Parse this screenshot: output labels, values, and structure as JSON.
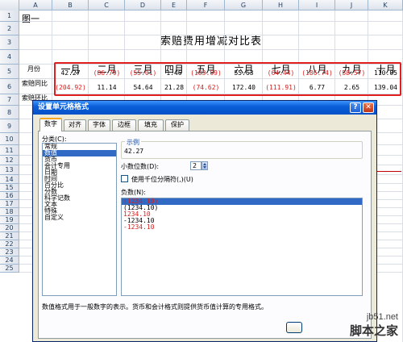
{
  "columns": [
    "A",
    "B",
    "C",
    "D",
    "E",
    "F",
    "G",
    "H",
    "I",
    "J",
    "K"
  ],
  "rows": [
    "1",
    "2",
    "3",
    "4",
    "5",
    "6",
    "7",
    "8",
    "9",
    "10",
    "11",
    "12",
    "13",
    "14",
    "15",
    "16",
    "17",
    "18",
    "19",
    "20",
    "21",
    "22",
    "23",
    "24",
    "25"
  ],
  "sheet": {
    "a1": "图一",
    "title": "索赔费用增减对比表",
    "month_header_label": "月份",
    "months": [
      "一月",
      "二月",
      "三月",
      "四月",
      "五月",
      "六月",
      "七月",
      "八月",
      "九月",
      "十月"
    ],
    "row4_label": "索赔同比",
    "row4_values": [
      "42.27",
      "(86.79)",
      "(55.01)",
      "1.46",
      "(183.69)",
      "55.63",
      "(64.44)",
      "(186.74)",
      "(58.57)",
      "110.05"
    ],
    "row4_negative": [
      false,
      true,
      true,
      false,
      true,
      false,
      true,
      true,
      true,
      false
    ],
    "row5_label": "索赔环比",
    "row5_values": [
      "(204.92)",
      "11.14",
      "54.64",
      "21.28",
      "(74.62)",
      "172.40",
      "(111.91)",
      "6.77",
      "2.65",
      "139.04"
    ],
    "row5_negative": [
      true,
      false,
      false,
      false,
      true,
      false,
      true,
      false,
      false,
      false
    ]
  },
  "dialog": {
    "title": "设置单元格格式",
    "help_label": "?",
    "close_label": "✕",
    "tabs": [
      "数字",
      "对齐",
      "字体",
      "边框",
      "填充",
      "保护"
    ],
    "category_label": "分类(C):",
    "categories": [
      "常规",
      "数值",
      "货币",
      "会计专用",
      "日期",
      "时间",
      "百分比",
      "分数",
      "科学记数",
      "文本",
      "特殊",
      "自定义"
    ],
    "selected_category": "数值",
    "sample_label": "示例",
    "sample_value": "42.27",
    "decimal_label": "小数位数(D):",
    "decimal_value": "2",
    "thousands_label": "使用千位分隔符(,)(U)",
    "negative_label": "负数(N):",
    "negative_formats": [
      "(1234.10)",
      "(1234.10)",
      "1234.10",
      "-1234.10",
      "-1234.10"
    ],
    "negative_formats_red": [
      true,
      false,
      true,
      false,
      true
    ],
    "description": "数值格式用于一般数字的表示。货币和会计格式则提供货币值计算的专用格式。"
  },
  "watermark": {
    "site": "jb51.net",
    "name": "脚本之家"
  },
  "colors": {
    "negative": "#d81e1e",
    "highlight_box": "#e02020",
    "selection": "#316ac5",
    "titlebar": "#0a5fd8"
  }
}
